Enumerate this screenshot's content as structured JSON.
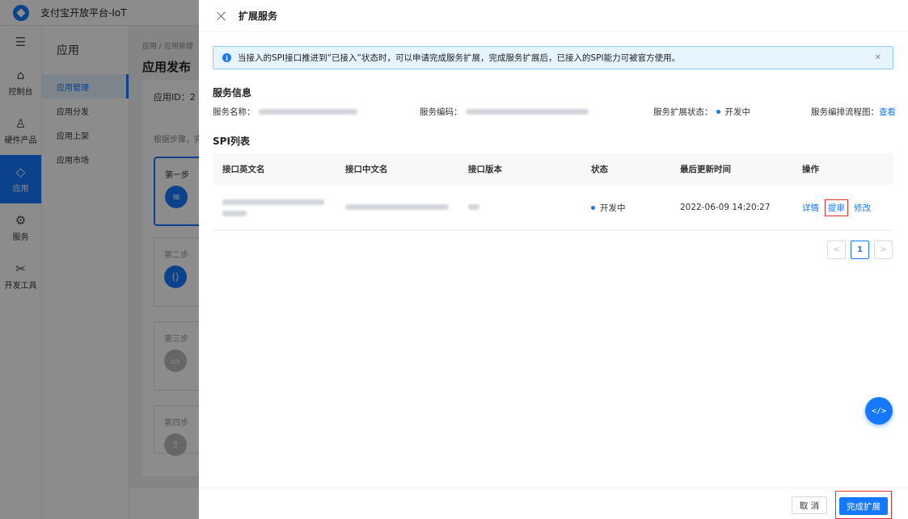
{
  "app": {
    "title": "支付宝开放平台-IoT"
  },
  "leftnav": [
    {
      "label": "控制台",
      "icon": "home-icon"
    },
    {
      "label": "硬件产品",
      "icon": "hardware-icon"
    },
    {
      "label": "应用",
      "icon": "apps-icon",
      "active": true
    },
    {
      "label": "服务",
      "icon": "gear-icon"
    },
    {
      "label": "开发工具",
      "icon": "tools-icon"
    }
  ],
  "subnav": {
    "title": "应用",
    "items": [
      "应用管理",
      "应用分发",
      "应用上架",
      "应用市场"
    ]
  },
  "main": {
    "breadcrumb": "应用 / 应用管理",
    "title": "应用发布",
    "app_id_label": "应用ID：2",
    "steps_hint": "根据步骤，完",
    "steps": [
      "第一步",
      "第二步",
      "第三步",
      "第四步"
    ]
  },
  "drawer": {
    "title": "扩展服务",
    "alert": "当接入的SPI接口推进到“已接入”状态时，可以申请完成服务扩展，完成服务扩展后，已接入的SPI能力可被官方使用。",
    "service_info_title": "服务信息",
    "service_name_label": "服务名称：",
    "service_code_label": "服务编码：",
    "ext_status_label": "服务扩展状态：",
    "ext_status_value": "开发中",
    "flow_label": "服务编排流程图：",
    "flow_link": "查看",
    "spi_title": "SPI列表",
    "columns": [
      "接口英文名",
      "接口中文名",
      "接口版本",
      "状态",
      "最后更新时间",
      "操作"
    ],
    "rows": [
      {
        "status": "开发中",
        "updated": "2022-06-09 14:20:27",
        "actions": [
          "详情",
          "提审",
          "修改"
        ]
      }
    ],
    "pagination": {
      "prev": "<",
      "current": "1",
      "next": ">"
    },
    "cancel_label": "取 消",
    "confirm_label": "完成扩展"
  },
  "colors": {
    "primary": "#1677ff",
    "highlight": "#e03030"
  }
}
